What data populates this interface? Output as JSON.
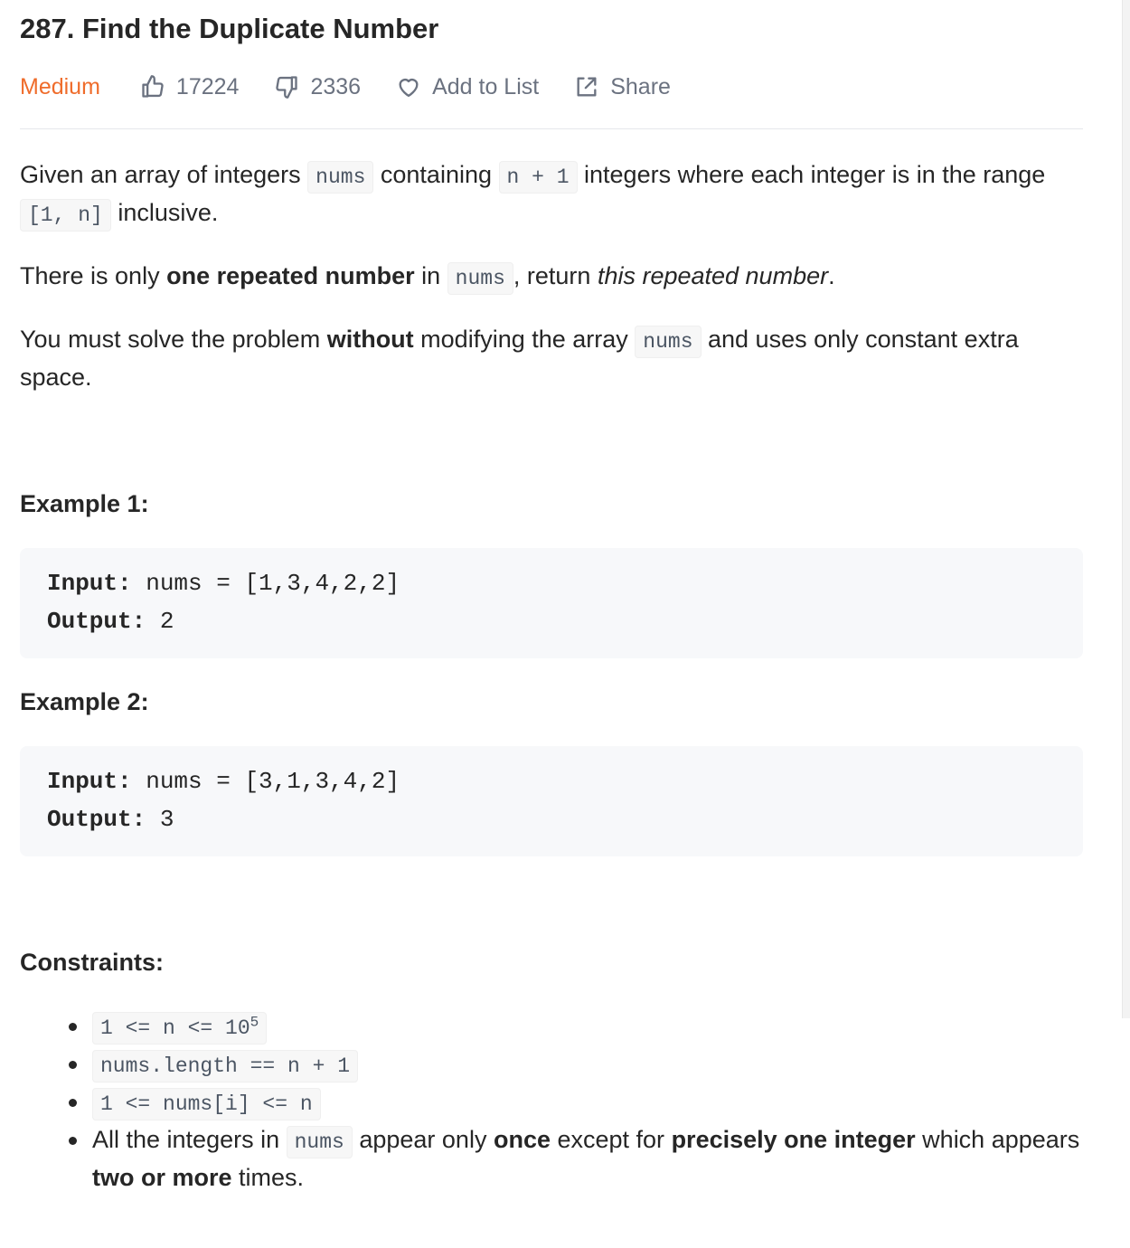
{
  "problem": {
    "title": "287. Find the Duplicate Number",
    "difficulty": "Medium",
    "likes": "17224",
    "dislikes": "2336",
    "add_to_list_label": "Add to List",
    "share_label": "Share"
  },
  "description": {
    "p1": {
      "t1": "Given an array of integers ",
      "c1": "nums",
      "t2": " containing ",
      "c2": "n + 1",
      "t3": " integers where each integer is in the range ",
      "c3": "[1, n]",
      "t4": " inclusive."
    },
    "p2": {
      "t1": "There is only ",
      "b1": "one repeated number",
      "t2": " in ",
      "c1": "nums",
      "t3": ", return ",
      "i1": "this repeated number",
      "t4": "."
    },
    "p3": {
      "t1": "You must solve the problem ",
      "b1": "without",
      "t2": " modifying the array ",
      "c1": "nums",
      "t3": " and uses only constant extra space."
    }
  },
  "examples": [
    {
      "heading": "Example 1:",
      "input_label": "Input:",
      "input_value": " nums = [1,3,4,2,2]",
      "output_label": "Output:",
      "output_value": " 2"
    },
    {
      "heading": "Example 2:",
      "input_label": "Input:",
      "input_value": " nums = [3,1,3,4,2]",
      "output_label": "Output:",
      "output_value": " 3"
    }
  ],
  "constraints": {
    "heading": "Constraints:",
    "c1_base": "1 <= n <= 10",
    "c1_exp": "5",
    "c2": "nums.length == n + 1",
    "c3": "1 <= nums[i] <= n",
    "c4": {
      "t1": "All the integers in ",
      "c1": "nums",
      "t2": " appear only ",
      "b1": "once",
      "t3": " except for ",
      "b2": "precisely one integer",
      "t4": " which appears ",
      "b3": "two or more",
      "t5": " times."
    }
  },
  "colors": {
    "difficulty_medium": "#ef6c2b",
    "meta_gray": "#6b7280",
    "text": "#262626",
    "code_bg": "#f7f7f7",
    "example_bg": "#f7f8fa"
  }
}
